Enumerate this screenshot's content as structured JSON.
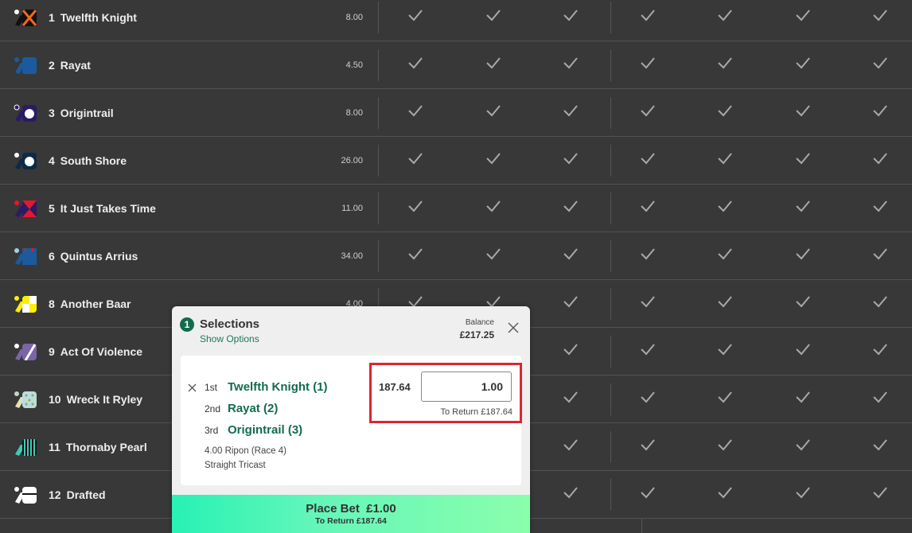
{
  "runners": [
    {
      "number": "1",
      "name": "Twelfth Knight",
      "odds": "8.00",
      "silk": "twelfth-knight-silk"
    },
    {
      "number": "2",
      "name": "Rayat",
      "odds": "4.50",
      "silk": "rayat-silk"
    },
    {
      "number": "3",
      "name": "Origintrail",
      "odds": "8.00",
      "silk": "origintrail-silk"
    },
    {
      "number": "4",
      "name": "South Shore",
      "odds": "26.00",
      "silk": "south-shore-silk"
    },
    {
      "number": "5",
      "name": "It Just Takes Time",
      "odds": "11.00",
      "silk": "it-just-takes-time-silk"
    },
    {
      "number": "6",
      "name": "Quintus Arrius",
      "odds": "34.00",
      "silk": "quintus-arrius-silk"
    },
    {
      "number": "8",
      "name": "Another Baar",
      "odds": "4.00",
      "silk": "another-baar-silk"
    },
    {
      "number": "9",
      "name": "Act Of Violence",
      "odds": "",
      "silk": "act-of-violence-silk"
    },
    {
      "number": "10",
      "name": "Wreck It Ryley",
      "odds": "",
      "silk": "wreck-it-ryley-silk"
    },
    {
      "number": "11",
      "name": "Thornaby Pearl",
      "odds": "",
      "silk": "thornaby-pearl-silk"
    },
    {
      "number": "12",
      "name": "Drafted",
      "odds": "",
      "silk": "drafted-silk"
    }
  ],
  "check_columns": 7,
  "betslip": {
    "count": "1",
    "title": "Selections",
    "show_options": "Show Options",
    "balance_label": "Balance",
    "balance": "£217.25",
    "selections": [
      {
        "position": "1st",
        "horse": "Twelfth Knight (1)"
      },
      {
        "position": "2nd",
        "horse": "Rayat (2)"
      },
      {
        "position": "3rd",
        "horse": "Origintrail (3)"
      }
    ],
    "race": "4.00 Ripon (Race 4)",
    "bet_type": "Straight Tricast",
    "odds": "187.64",
    "stake": "1.00",
    "to_return": "To Return £187.64",
    "place_bet_label": "Place Bet  £1.00",
    "place_bet_return": "To Return £187.64"
  },
  "colors": {
    "accent_green": "#136b4f",
    "highlight_red": "#e0242d",
    "background": "#383838"
  }
}
